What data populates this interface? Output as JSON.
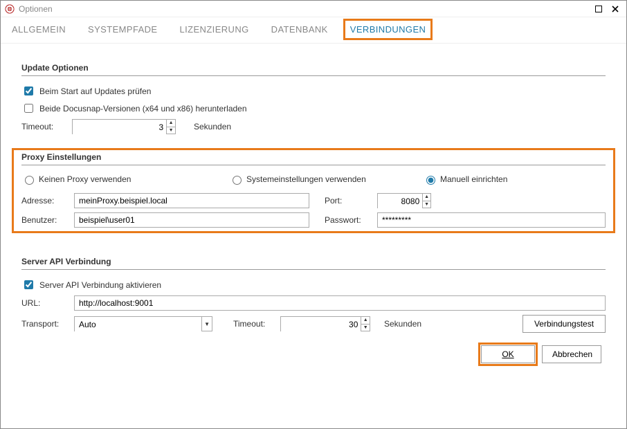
{
  "window": {
    "title": "Optionen"
  },
  "tabs": [
    "ALLGEMEIN",
    "SYSTEMPFADE",
    "LIZENZIERUNG",
    "DATENBANK",
    "VERBINDUNGEN"
  ],
  "active_tab_index": 4,
  "sections": {
    "update": {
      "title": "Update Optionen",
      "check_on_start": "Beim Start auf Updates prüfen",
      "download_both": "Beide Docusnap-Versionen (x64 und x86) herunterladen",
      "timeout_label": "Timeout:",
      "timeout_value": "3",
      "seconds": "Sekunden"
    },
    "proxy": {
      "title": "Proxy Einstellungen",
      "no_proxy": "Keinen Proxy verwenden",
      "system": "Systemeinstellungen verwenden",
      "manual": "Manuell einrichten",
      "address_label": "Adresse:",
      "address_value": "meinProxy.beispiel.local",
      "port_label": "Port:",
      "port_value": "8080",
      "user_label": "Benutzer:",
      "user_value": "beispiel\\user01",
      "password_label": "Passwort:",
      "password_value": "*********"
    },
    "api": {
      "title": "Server API Verbindung",
      "activate": "Server API Verbindung aktivieren",
      "url_label": "URL:",
      "url_value": "http://localhost:9001",
      "transport_label": "Transport:",
      "transport_value": "Auto",
      "timeout_label": "Timeout:",
      "timeout_value": "30",
      "seconds": "Sekunden",
      "test_btn": "Verbindungstest"
    }
  },
  "buttons": {
    "ok": "OK",
    "cancel": "Abbrechen"
  },
  "colors": {
    "highlight": "#e87a1a",
    "link": "#1f7aa9"
  }
}
